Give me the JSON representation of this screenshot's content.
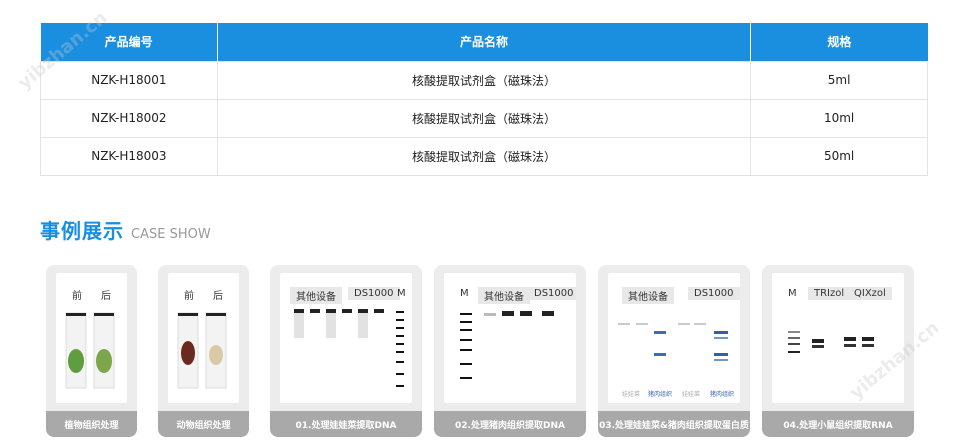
{
  "table": {
    "headers": [
      "产品编号",
      "产品名称",
      "规格"
    ],
    "rows": [
      [
        "NZK-H18001",
        "核酸提取试剂盒（磁珠法）",
        "5ml"
      ],
      [
        "NZK-H18002",
        "核酸提取试剂盒（磁珠法）",
        "10ml"
      ],
      [
        "NZK-H18003",
        "核酸提取试剂盒（磁珠法）",
        "50ml"
      ]
    ]
  },
  "section": {
    "title_cn": "事例展示",
    "title_en": "CASE SHOW"
  },
  "cases": [
    {
      "caption": "植物组织处理",
      "labels": [
        "前",
        "后"
      ]
    },
    {
      "caption": "动物组织处理",
      "labels": [
        "前",
        "后"
      ]
    },
    {
      "caption": "01.处理娃娃菜提取DNA",
      "labels": [
        "其他设备",
        "DS1000",
        "M"
      ]
    },
    {
      "caption": "02.处理猪肉组织提取DNA",
      "labels": [
        "M",
        "其他设备",
        "DS1000"
      ]
    },
    {
      "caption": "03.处理娃娃菜&猪肉组织提取蛋白质",
      "labels": [
        "其他设备",
        "DS1000"
      ],
      "lane_labels": [
        "娃娃菜",
        "猪肉组织",
        "娃娃菜",
        "猪肉组织"
      ]
    },
    {
      "caption": "04.处理小鼠组织提取RNA",
      "labels": [
        "M",
        "TRIzol",
        "QIXzol"
      ]
    }
  ],
  "watermarks": [
    "yibzhan.cn",
    "yibzhan.cn"
  ]
}
